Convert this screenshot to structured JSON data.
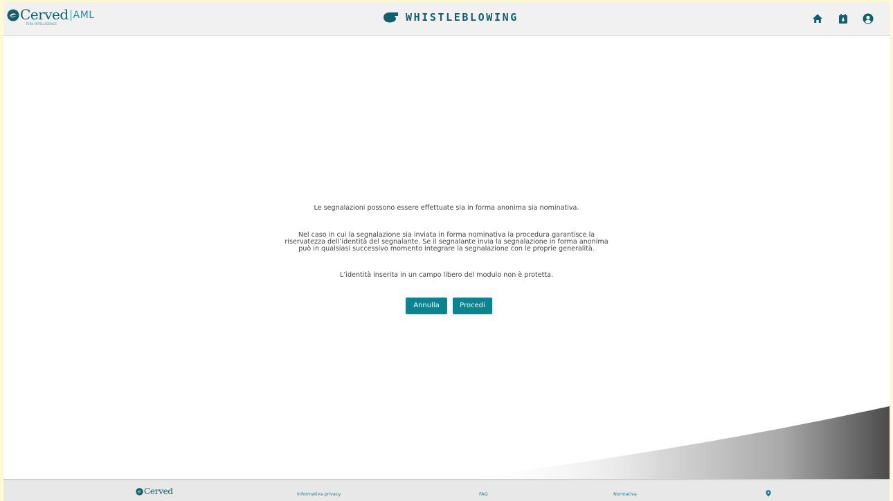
{
  "header": {
    "logo_word": "Cerved",
    "logo_product": "AML",
    "logo_tagline": "RISK INTELLIGENCE",
    "app_title": "WHISTLEBLOWING",
    "icons": [
      "home-icon",
      "download-calendar-icon",
      "user-account-icon"
    ]
  },
  "main": {
    "paragraph1": "Le segnalazioni possono essere effettuate sia in forma anonima sia nominativa.",
    "paragraph2": "Nel caso in cui la segnalazione sia inviata in forma nominativa la procedura garantisce la\nriservatezza dell’identità del segnalante. Se il segnalante invia la segnalazione in forma anonima\npuò in qualsiasi successivo momento integrare la segnalazione con le proprie generalità.",
    "paragraph3": "L’identità inserita in un campo libero del modulo non è protetta.",
    "cancel_label": "Annulla",
    "proceed_label": "Procedi"
  },
  "footer": {
    "logo_word": "Cerved",
    "privacy_label": "Informativa privacy",
    "faq_label": "FAQ",
    "normativa_label": "Normativa",
    "location_icon": "map-pin-icon"
  },
  "colors": {
    "brand_teal": "#0f5f6c",
    "button_teal": "#0e8390",
    "link_teal": "#0f7e8a"
  }
}
